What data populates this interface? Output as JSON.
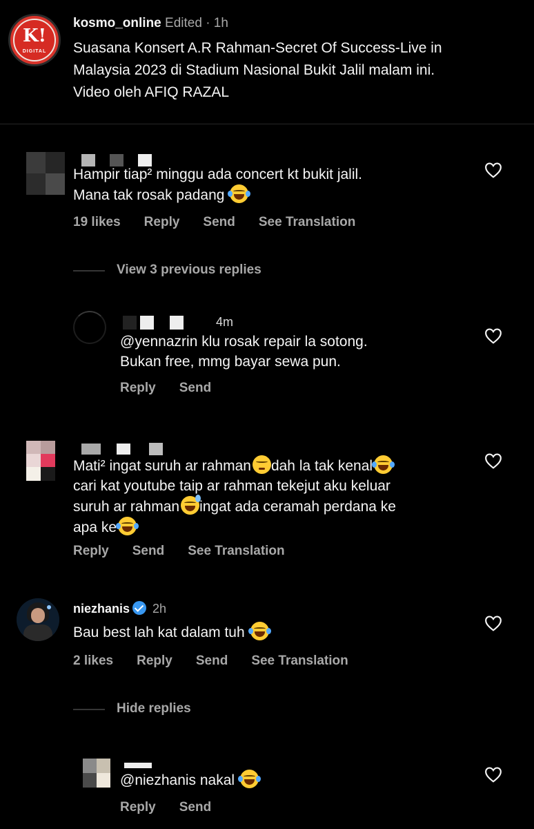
{
  "post": {
    "username": "kosmo_online",
    "edited": "Edited",
    "separator": "·",
    "time": "1h",
    "avatar_logo": "K!",
    "avatar_sub": "DIGITAL",
    "caption_line1": "Suasana Konsert A.R Rahman-Secret Of Success-Live in",
    "caption_line2": "Malaysia 2023 di Stadium Nasional Bukit Jalil malam ini.",
    "caption_line3": "Video oleh AFIQ RAZAL"
  },
  "comments": [
    {
      "text_line1": "Hampir tiap² minggu ada concert kt bukit jalil.",
      "text_line2": "Mana tak rosak padang",
      "likes": "19 likes",
      "reply": "Reply",
      "send": "Send",
      "translate": "See Translation",
      "view_replies": "View 3 previous replies",
      "replies": [
        {
          "time": "4m",
          "text_line1": "@yennazrin klu rosak repair la sotong.",
          "text_line2": "Bukan free, mmg bayar sewa pun.",
          "reply": "Reply",
          "send": "Send"
        }
      ]
    },
    {
      "text_line1a": "Mati² ingat suruh ar rahman",
      "text_line1b": "dah la tak kenal",
      "text_line2": "cari kat youtube taip ar rahman tekejut aku keluar",
      "text_line3a": "suruh ar rahman",
      "text_line3b": "ingat ada ceramah perdana ke",
      "text_line4": "apa ke",
      "reply": "Reply",
      "send": "Send",
      "translate": "See Translation"
    },
    {
      "username": "niezhanis",
      "time": "2h",
      "text": "Bau best lah kat dalam tuh",
      "likes": "2 likes",
      "reply": "Reply",
      "send": "Send",
      "translate": "See Translation",
      "hide_replies": "Hide replies",
      "replies": [
        {
          "text": "@niezhanis nakal",
          "reply": "Reply",
          "send": "Send"
        }
      ]
    }
  ],
  "icons": {
    "heart": "heart-outline-icon",
    "laugh": "face-with-tears-of-joy-emoji",
    "unamused": "unamused-face-emoji",
    "sweat": "grinning-face-with-sweat-emoji",
    "verified": "verified-badge-icon"
  },
  "colors": {
    "background": "#000000",
    "text": "#f5f5f5",
    "muted": "#a8a8a8",
    "verified": "#3897f0",
    "brand": "#d62b23"
  }
}
